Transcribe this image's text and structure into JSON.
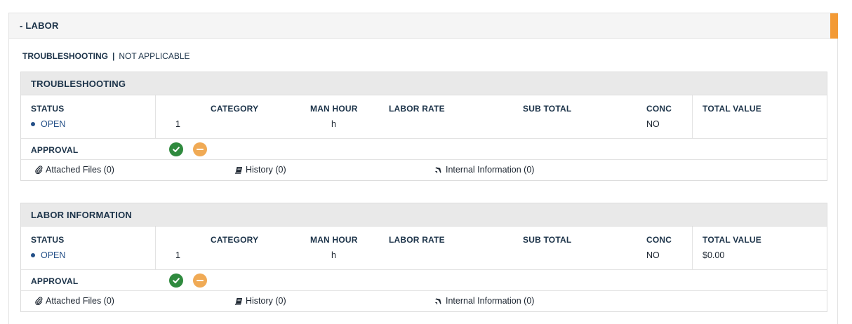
{
  "section": {
    "title": "- LABOR",
    "accent_color": "#f39a35"
  },
  "subnav": {
    "active": "TROUBLESHOOTING",
    "separator": "|",
    "other": "NOT APPLICABLE"
  },
  "cards": [
    {
      "title": "TROUBLESHOOTING",
      "labels": {
        "status": "STATUS",
        "category": "CATEGORY",
        "man_hour": "MAN HOUR",
        "labor_rate": "LABOR RATE",
        "sub_total": "SUB TOTAL",
        "conc": "CONC",
        "total_value": "TOTAL VALUE",
        "approval": "APPROVAL"
      },
      "values": {
        "status": "OPEN",
        "category": "1",
        "man_hour": "h",
        "labor_rate": "",
        "sub_total": "",
        "conc": "NO",
        "total_value": ""
      },
      "links": {
        "attached_files": "Attached Files (0)",
        "history": "History (0)",
        "internal_info": "Internal Information (0)"
      }
    },
    {
      "title": "LABOR INFORMATION",
      "labels": {
        "status": "STATUS",
        "category": "CATEGORY",
        "man_hour": "MAN HOUR",
        "labor_rate": "LABOR RATE",
        "sub_total": "SUB TOTAL",
        "conc": "CONC",
        "total_value": "TOTAL VALUE",
        "approval": "APPROVAL"
      },
      "values": {
        "status": "OPEN",
        "category": "1",
        "man_hour": "h",
        "labor_rate": "",
        "sub_total": "",
        "conc": "NO",
        "total_value": "$0.00"
      },
      "links": {
        "attached_files": "Attached Files (0)",
        "history": "History (0)",
        "internal_info": "Internal Information (0)"
      }
    }
  ],
  "icons": {
    "approve": "check-circle-icon",
    "reject": "minus-circle-icon",
    "attach": "paperclip-icon",
    "history": "book-icon",
    "internal": "airplane-icon"
  },
  "colors": {
    "status": "#234f87",
    "approve": "#2f8a3e",
    "reject": "#f0aa55"
  }
}
